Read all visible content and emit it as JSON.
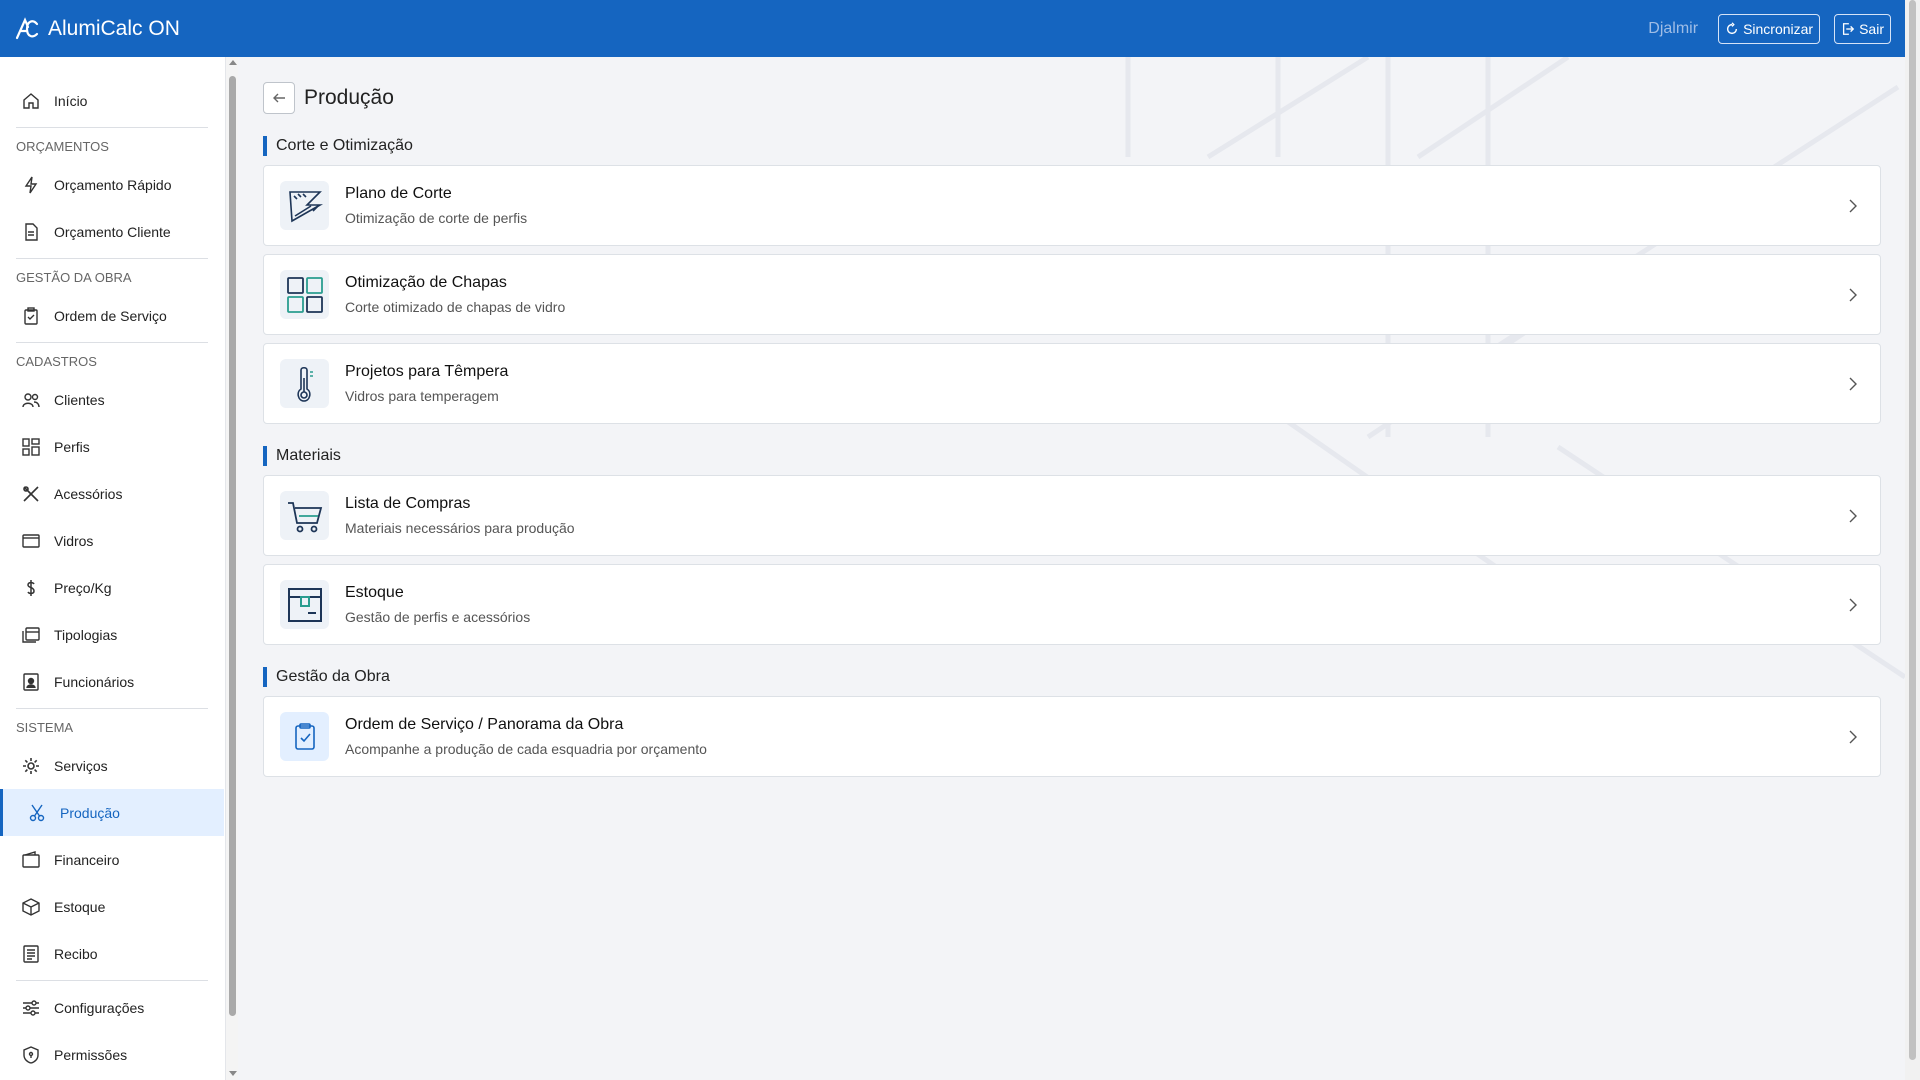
{
  "app": {
    "title": "AlumiCalc ON",
    "user": "Djalmir",
    "sync_label": "Sincronizar",
    "logout_label": "Sair"
  },
  "sidebar": {
    "home": "Início",
    "sections": {
      "orcamentos": "ORÇAMENTOS",
      "gestao": "GESTÃO DA OBRA",
      "cadastros": "CADASTROS",
      "sistema": "SISTEMA"
    },
    "items": {
      "orcamento_rapido": "Orçamento Rápido",
      "orcamento_cliente": "Orçamento Cliente",
      "ordem_servico": "Ordem de Serviço",
      "clientes": "Clientes",
      "perfis": "Perfis",
      "acessorios": "Acessórios",
      "vidros": "Vidros",
      "preco_kg": "Preço/Kg",
      "tipologias": "Tipologias",
      "funcionarios": "Funcionários",
      "servicos": "Serviços",
      "producao": "Produção",
      "financeiro": "Financeiro",
      "estoque": "Estoque",
      "recibo": "Recibo",
      "configuracoes": "Configurações",
      "permissoes": "Permissões"
    }
  },
  "page": {
    "title": "Produção",
    "sections": [
      {
        "title": "Corte e Otimização",
        "cards": [
          {
            "title": "Plano de Corte",
            "subtitle": "Otimização de corte de perfis",
            "icon": "ruler-cut-icon"
          },
          {
            "title": "Otimização de Chapas",
            "subtitle": "Corte otimizado de chapas de vidro",
            "icon": "grid-sheets-icon"
          },
          {
            "title": "Projetos para Têmpera",
            "subtitle": "Vidros para temperagem",
            "icon": "thermometer-icon"
          }
        ]
      },
      {
        "title": "Materiais",
        "cards": [
          {
            "title": "Lista de Compras",
            "subtitle": "Materiais necessários para produção",
            "icon": "cart-icon"
          },
          {
            "title": "Estoque",
            "subtitle": "Gestão de perfis e acessórios",
            "icon": "box-icon"
          }
        ]
      },
      {
        "title": "Gestão da Obra",
        "cards": [
          {
            "title": "Ordem de Serviço / Panorama da Obra",
            "subtitle": "Acompanhe a produção de cada esquadria por orçamento",
            "icon": "clipboard-check-icon"
          }
        ]
      }
    ]
  },
  "colors": {
    "primary": "#1565c0",
    "background": "#f3f4f7",
    "active_bg": "#e3efff"
  }
}
